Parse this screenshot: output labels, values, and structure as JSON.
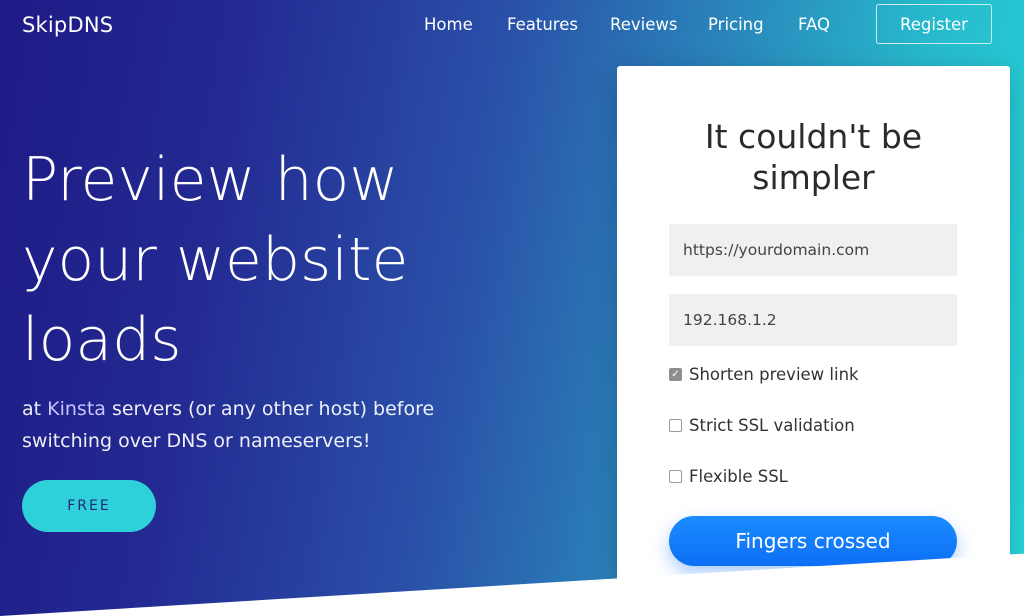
{
  "header": {
    "logo": "SkipDNS",
    "nav": {
      "home": "Home",
      "features": "Features",
      "reviews": "Reviews",
      "pricing": "Pricing",
      "faq": "FAQ"
    },
    "register_label": "Register"
  },
  "hero": {
    "title_line1": "Preview how",
    "title_line2": "your website",
    "title_line3": "loads",
    "subtitle_pre": "at ",
    "subtitle_link": "Kinsta",
    "subtitle_post": " servers (or any other host) before switching over DNS or nameservers!",
    "cta_label": "FREE"
  },
  "form": {
    "title_line1": "It couldn't be",
    "title_line2": "simpler",
    "domain_value": "https://yourdomain.com",
    "ip_value": "192.168.1.2",
    "options": {
      "shorten_label": "Shorten preview link",
      "shorten_checked": true,
      "strict_ssl_label": "Strict SSL validation",
      "strict_ssl_checked": false,
      "flexible_ssl_label": "Flexible SSL",
      "flexible_ssl_checked": false
    },
    "submit_label": "Fingers crossed"
  },
  "colors": {
    "gradient_start": "#1f1a86",
    "gradient_end": "#26d6da",
    "cta_button": "#2ed0d9",
    "submit_button": "#0d6ff5"
  }
}
